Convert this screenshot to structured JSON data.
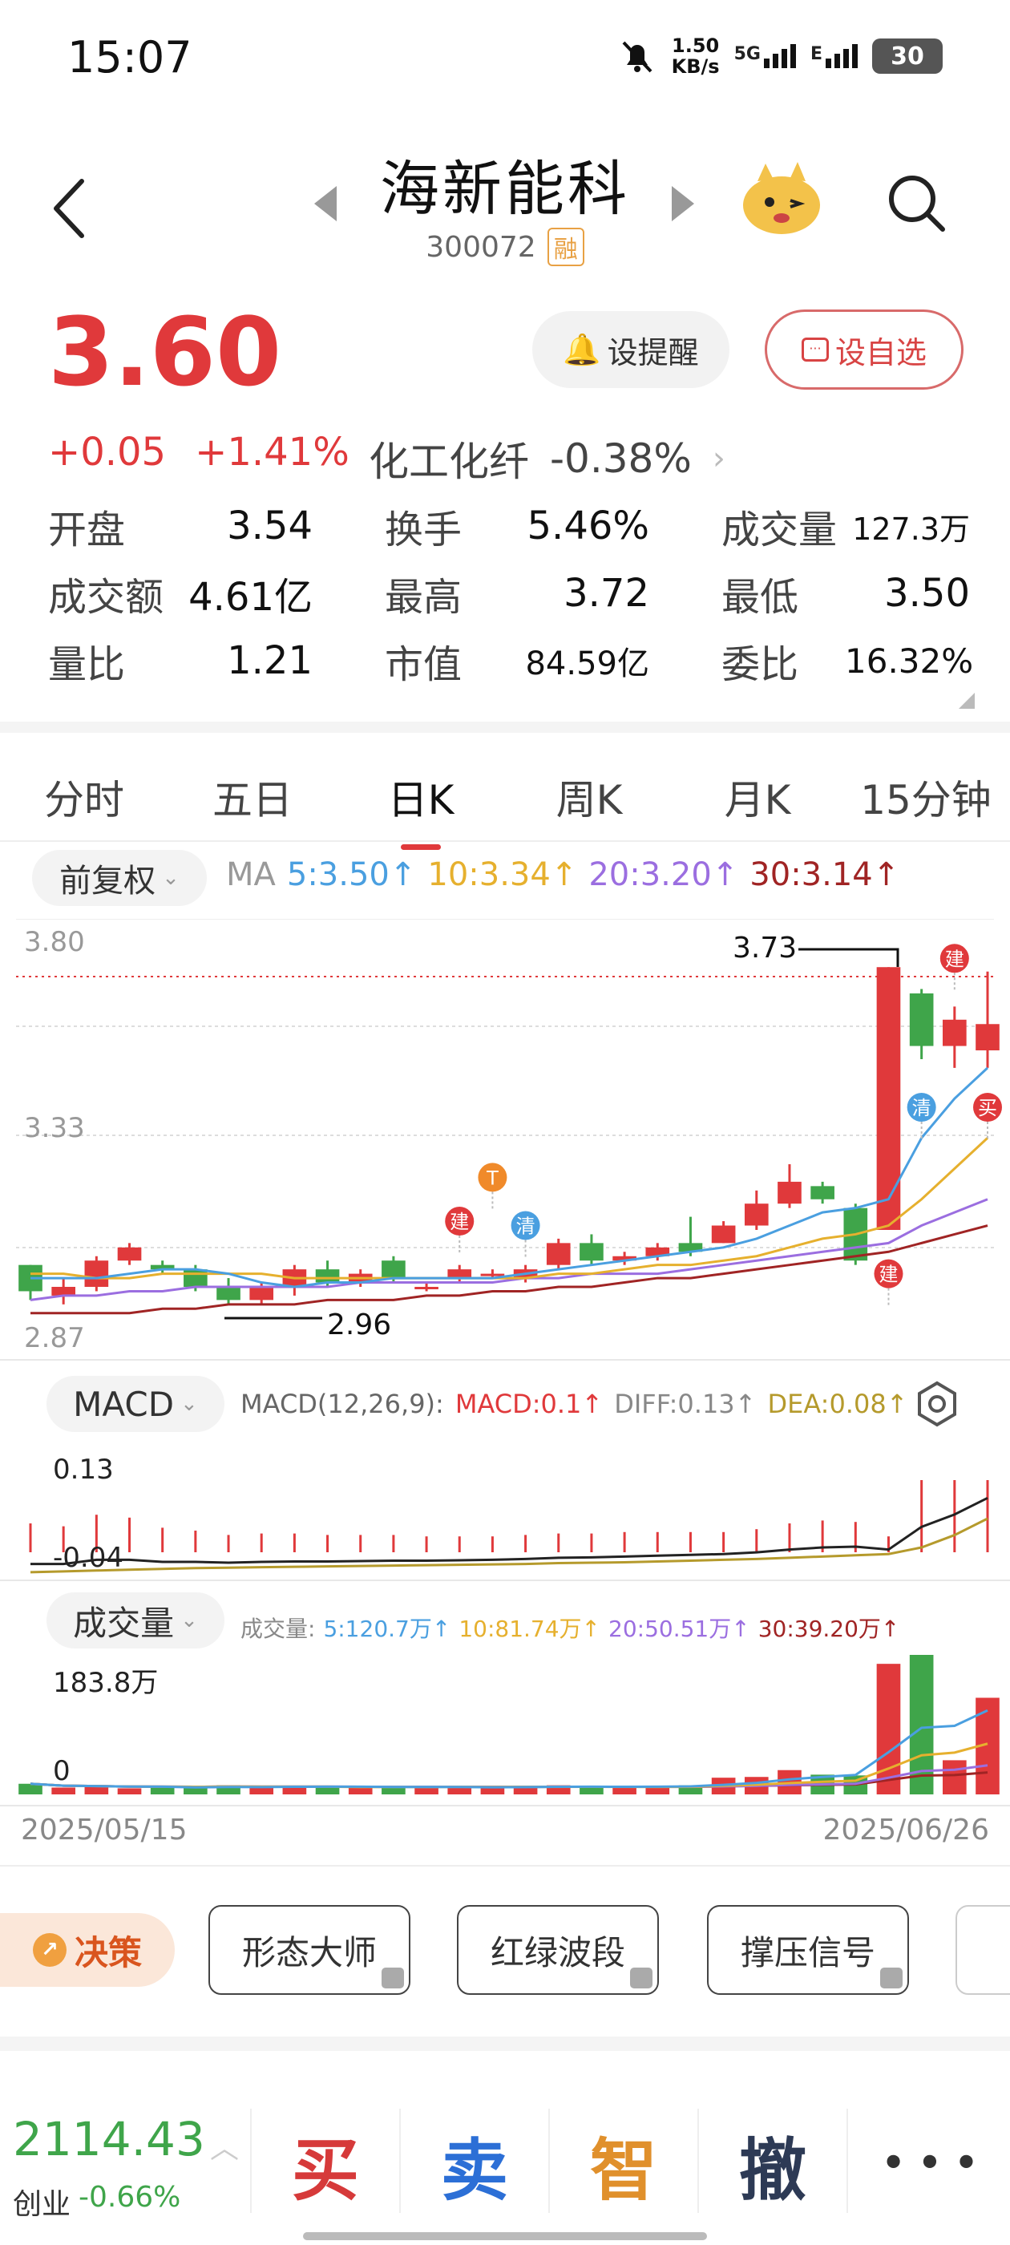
{
  "status_bar": {
    "time": "15:07",
    "speed_value": "1.50",
    "speed_unit": "KB/s",
    "network_1": "5G",
    "network_2": "E",
    "battery": "30"
  },
  "header": {
    "name": "海新能科",
    "code": "300072",
    "margin_tag": "融"
  },
  "quote": {
    "price": "3.60",
    "change": "+0.05",
    "change_pct": "+1.41%",
    "sector_name": "化工化纤",
    "sector_chg": "-0.38%",
    "remind_label": "设提醒",
    "fav_label": "设自选"
  },
  "stats": {
    "open_lbl": "开盘",
    "open": "3.54",
    "turnover_lbl": "换手",
    "turnover": "5.46%",
    "volume_lbl": "成交量",
    "volume": "127.3万",
    "amount_lbl": "成交额",
    "amount": "4.61亿",
    "high_lbl": "最高",
    "high": "3.72",
    "low_lbl": "最低",
    "low": "3.50",
    "vol_ratio_lbl": "量比",
    "vol_ratio": "1.21",
    "mktcap_lbl": "市值",
    "mktcap": "84.59亿",
    "bid_ratio_lbl": "委比",
    "bid_ratio": "16.32%"
  },
  "tabs": [
    "分时",
    "五日",
    "日K",
    "周K",
    "月K",
    "15分钟"
  ],
  "ma_row": {
    "adjust": "前复权",
    "ma_label": "MA",
    "ma5": "5:3.50↑",
    "ma10": "10:3.34↑",
    "ma20": "20:3.20↑",
    "ma30": "30:3.14↑"
  },
  "chart_labels": {
    "y_top": "3.80",
    "y_mid": "3.33",
    "y_bot": "2.87",
    "max_label": "3.73",
    "min_label": "2.96",
    "macd_top": "0.13",
    "macd_bot": "-0.04",
    "vol_top": "183.8万",
    "vol_bot": "0",
    "date_start": "2025/05/15",
    "date_end": "2025/06/26",
    "mark_build": "建",
    "mark_clear": "清",
    "mark_t": "T",
    "mark_buy": "买"
  },
  "macd": {
    "button": "MACD",
    "params": "MACD(12,26,9):",
    "macd": "MACD:0.1↑",
    "diff": "DIFF:0.13↑",
    "dea": "DEA:0.08↑"
  },
  "volume": {
    "button": "成交量",
    "prefix": "成交量:",
    "ma5": "5:120.7万↑",
    "ma10": "10:81.74万↑",
    "ma20": "20:50.51万↑",
    "ma30": "30:39.20万↑"
  },
  "tools": {
    "decision": "决策",
    "t1": "形态大师",
    "t2": "红绿波段",
    "t3": "撑压信号"
  },
  "bottom": {
    "index_value": "2114.43",
    "index_name": "创业",
    "index_chg": "-0.66%",
    "buy": "买",
    "sell": "卖",
    "smart": "智",
    "cancel": "撤",
    "more": "• • •"
  },
  "colors": {
    "red": "#e0393b",
    "green": "#3fa54a",
    "ma5": "#4a9fe0",
    "ma10": "#e6b02e",
    "ma20": "#9b6ee0",
    "ma30": "#a02424"
  },
  "chart_data": {
    "type": "candlestick",
    "x_start": "2025/05/15",
    "x_end": "2025/06/26",
    "ylim": [
      2.87,
      3.8
    ],
    "candles": [
      {
        "o": 3.05,
        "c": 2.99,
        "h": 3.05,
        "l": 2.97
      },
      {
        "o": 2.98,
        "c": 3.0,
        "h": 3.02,
        "l": 2.96
      },
      {
        "o": 3.0,
        "c": 3.06,
        "h": 3.07,
        "l": 2.99
      },
      {
        "o": 3.06,
        "c": 3.09,
        "h": 3.1,
        "l": 3.05
      },
      {
        "o": 3.05,
        "c": 3.04,
        "h": 3.06,
        "l": 3.03
      },
      {
        "o": 3.04,
        "c": 3.0,
        "h": 3.05,
        "l": 2.99
      },
      {
        "o": 3.0,
        "c": 2.97,
        "h": 3.02,
        "l": 2.96
      },
      {
        "o": 2.97,
        "c": 3.0,
        "h": 3.01,
        "l": 2.96
      },
      {
        "o": 3.0,
        "c": 3.04,
        "h": 3.05,
        "l": 2.98
      },
      {
        "o": 3.04,
        "c": 3.01,
        "h": 3.06,
        "l": 3.0
      },
      {
        "o": 3.01,
        "c": 3.03,
        "h": 3.04,
        "l": 3.0
      },
      {
        "o": 3.06,
        "c": 3.02,
        "h": 3.07,
        "l": 3.01
      },
      {
        "o": 3.0,
        "c": 3.0,
        "h": 3.01,
        "l": 2.99
      },
      {
        "o": 3.02,
        "c": 3.04,
        "h": 3.05,
        "l": 3.01
      },
      {
        "o": 3.03,
        "c": 3.03,
        "h": 3.04,
        "l": 3.02
      },
      {
        "o": 3.02,
        "c": 3.04,
        "h": 3.05,
        "l": 3.01
      },
      {
        "o": 3.05,
        "c": 3.1,
        "h": 3.11,
        "l": 3.04
      },
      {
        "o": 3.1,
        "c": 3.06,
        "h": 3.12,
        "l": 3.05
      },
      {
        "o": 3.06,
        "c": 3.07,
        "h": 3.08,
        "l": 3.05
      },
      {
        "o": 3.07,
        "c": 3.09,
        "h": 3.1,
        "l": 3.06
      },
      {
        "o": 3.1,
        "c": 3.08,
        "h": 3.16,
        "l": 3.07
      },
      {
        "o": 3.1,
        "c": 3.14,
        "h": 3.15,
        "l": 3.1
      },
      {
        "o": 3.14,
        "c": 3.19,
        "h": 3.22,
        "l": 3.13
      },
      {
        "o": 3.19,
        "c": 3.24,
        "h": 3.28,
        "l": 3.18
      },
      {
        "o": 3.23,
        "c": 3.2,
        "h": 3.24,
        "l": 3.19
      },
      {
        "o": 3.18,
        "c": 3.06,
        "h": 3.19,
        "l": 3.05
      },
      {
        "o": 3.13,
        "c": 3.73,
        "h": 3.73,
        "l": 3.13
      },
      {
        "o": 3.67,
        "c": 3.55,
        "h": 3.68,
        "l": 3.52
      },
      {
        "o": 3.55,
        "c": 3.61,
        "h": 3.64,
        "l": 3.5
      },
      {
        "o": 3.54,
        "c": 3.6,
        "h": 3.72,
        "l": 3.5
      }
    ],
    "ma5": [
      3.02,
      3.02,
      3.02,
      3.03,
      3.04,
      3.04,
      3.03,
      3.01,
      3.0,
      3.01,
      3.01,
      3.02,
      3.02,
      3.02,
      3.02,
      3.03,
      3.04,
      3.05,
      3.06,
      3.07,
      3.08,
      3.09,
      3.11,
      3.14,
      3.17,
      3.18,
      3.2,
      3.34,
      3.43,
      3.5
    ],
    "ma10": [
      3.03,
      3.03,
      3.02,
      3.02,
      3.03,
      3.03,
      3.03,
      3.03,
      3.02,
      3.02,
      3.02,
      3.02,
      3.02,
      3.02,
      3.02,
      3.02,
      3.03,
      3.03,
      3.04,
      3.05,
      3.05,
      3.06,
      3.07,
      3.09,
      3.11,
      3.12,
      3.14,
      3.2,
      3.27,
      3.34
    ],
    "ma20": [
      2.97,
      2.98,
      2.98,
      2.99,
      2.99,
      3.0,
      3.0,
      3.0,
      3.0,
      3.0,
      3.01,
      3.01,
      3.01,
      3.01,
      3.01,
      3.02,
      3.02,
      3.03,
      3.03,
      3.03,
      3.04,
      3.05,
      3.06,
      3.07,
      3.08,
      3.09,
      3.1,
      3.14,
      3.17,
      3.2
    ],
    "ma30": [
      2.94,
      2.94,
      2.94,
      2.94,
      2.95,
      2.95,
      2.96,
      2.96,
      2.96,
      2.97,
      2.97,
      2.97,
      2.98,
      2.98,
      2.99,
      2.99,
      3.0,
      3.0,
      3.01,
      3.02,
      3.02,
      3.03,
      3.04,
      3.05,
      3.06,
      3.07,
      3.08,
      3.1,
      3.12,
      3.14
    ],
    "volume_ylim": [
      0,
      183.8
    ],
    "volume": [
      14,
      9,
      10,
      8,
      10,
      9,
      12,
      9,
      10,
      11,
      9,
      10,
      9,
      10,
      9,
      10,
      12,
      10,
      9,
      10,
      12,
      22,
      23,
      32,
      26,
      25,
      172,
      183.8,
      45,
      127.3
    ],
    "macd_ylim": [
      -0.06,
      0.15
    ],
    "diff": [
      -0.03,
      -0.03,
      -0.02,
      -0.02,
      -0.025,
      -0.025,
      -0.027,
      -0.025,
      -0.024,
      -0.024,
      -0.023,
      -0.022,
      -0.022,
      -0.021,
      -0.02,
      -0.018,
      -0.015,
      -0.014,
      -0.012,
      -0.01,
      -0.008,
      -0.006,
      -0.002,
      0.005,
      0.01,
      0.012,
      0.005,
      0.06,
      0.09,
      0.13
    ],
    "dea": [
      -0.05,
      -0.048,
      -0.046,
      -0.044,
      -0.042,
      -0.04,
      -0.039,
      -0.038,
      -0.037,
      -0.036,
      -0.035,
      -0.034,
      -0.033,
      -0.032,
      -0.031,
      -0.03,
      -0.028,
      -0.027,
      -0.026,
      -0.024,
      -0.022,
      -0.02,
      -0.018,
      -0.015,
      -0.012,
      -0.009,
      -0.006,
      0.01,
      0.04,
      0.08
    ],
    "macd_bars": [
      0.04,
      0.036,
      0.052,
      0.048,
      0.034,
      0.03,
      0.024,
      0.026,
      0.026,
      0.024,
      0.024,
      0.024,
      0.022,
      0.022,
      0.022,
      0.024,
      0.026,
      0.026,
      0.028,
      0.028,
      0.028,
      0.028,
      0.032,
      0.04,
      0.044,
      0.042,
      0.022,
      0.1,
      0.1,
      0.1
    ]
  }
}
